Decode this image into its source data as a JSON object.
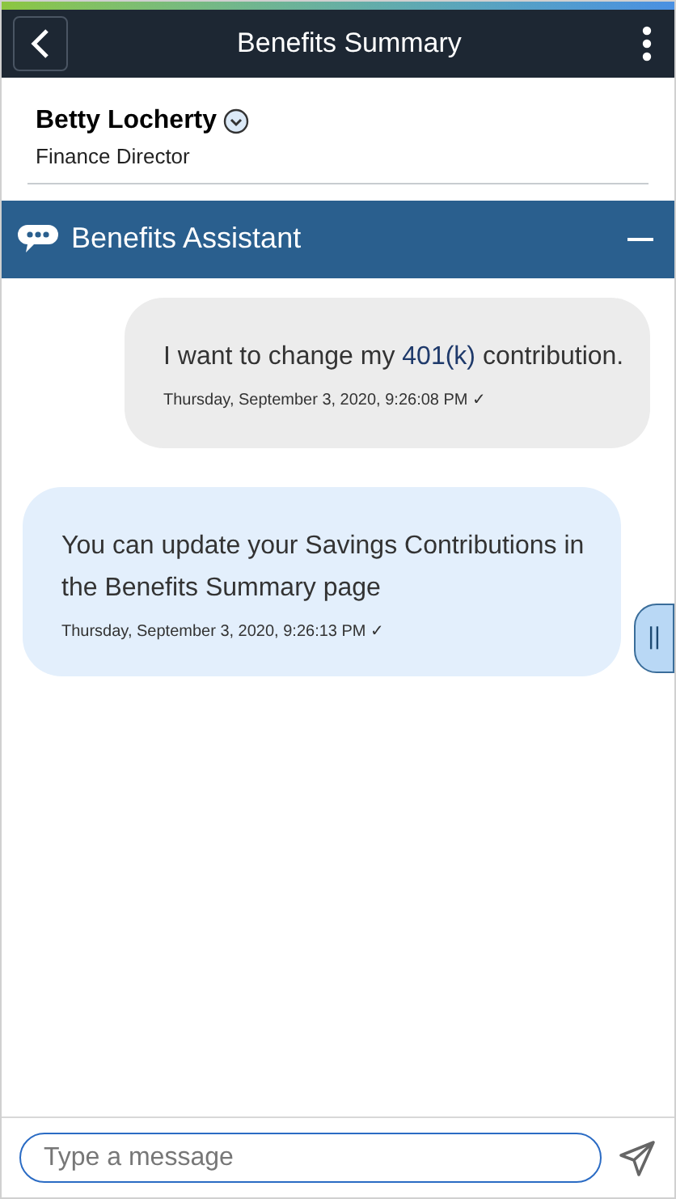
{
  "header": {
    "title": "Benefits Summary"
  },
  "profile": {
    "name": "Betty Locherty",
    "job_title": "Finance Director"
  },
  "assistant": {
    "title": "Benefits Assistant"
  },
  "messages": [
    {
      "kind": "sent",
      "parts": [
        {
          "text": "I want to change my "
        },
        {
          "text": "401(k)",
          "kind": "term"
        },
        {
          "text": " contribution."
        }
      ],
      "timestamp": "Thursday, September 3, 2020, 9:26:08 PM ✓"
    },
    {
      "kind": "received",
      "parts": [
        {
          "text": "You can update your Savings Contributions in the Benefits Summary page"
        }
      ],
      "timestamp": "Thursday, September 3, 2020, 9:26:13 PM ✓"
    }
  ],
  "side_tab": {
    "label": "||"
  },
  "composer": {
    "placeholder": "Type a message"
  }
}
